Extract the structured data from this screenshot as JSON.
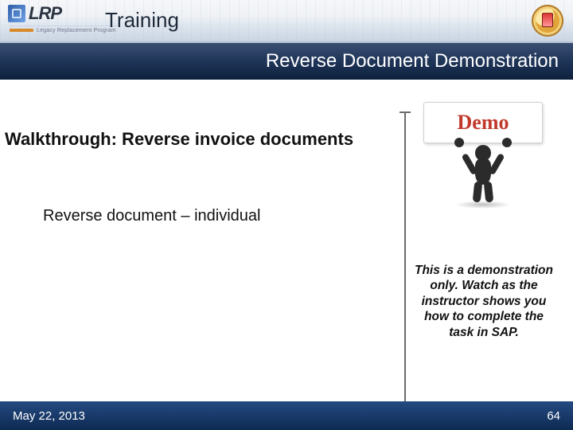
{
  "header": {
    "logo_text": "LRP",
    "logo_subtext": "Legacy Replacement Program",
    "title": "Training"
  },
  "subnav": {
    "title": "Reverse Document Demonstration"
  },
  "body": {
    "walkthrough_heading": "Walkthrough: Reverse invoice documents",
    "sub_point": "Reverse document – individual",
    "demo_label": "Demo",
    "note_text": "This is a demonstration only. Watch as the instructor shows you how to complete the task in SAP."
  },
  "footer": {
    "date": "May 22, 2013",
    "page_number": "64"
  }
}
